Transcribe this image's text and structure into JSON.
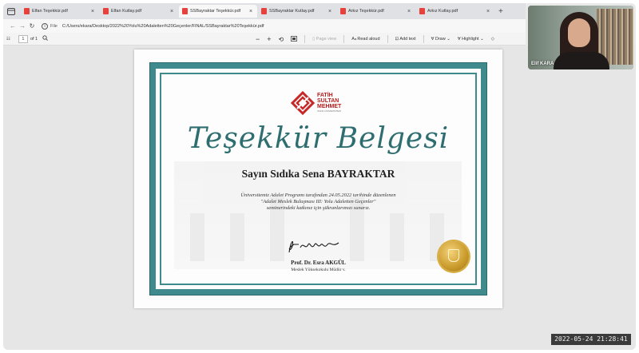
{
  "browser": {
    "tabs": [
      {
        "label": "Elfan Teşekkür.pdf",
        "active": false
      },
      {
        "label": "Elfan Kutlay.pdf",
        "active": false
      },
      {
        "label": "SSBayraktar Teşekkür.pdf",
        "active": true
      },
      {
        "label": "SSBayraktar Kutlay.pdf",
        "active": false
      },
      {
        "label": "Arkız Teşekkür.pdf",
        "active": false
      },
      {
        "label": "Arkız Kutlay.pdf",
        "active": false
      }
    ],
    "new_tab_label": "+",
    "address": {
      "scheme_label": "File",
      "url": "C:/Users/ekara/Desktop/2022%20Yolu%20Adaletten%20Geçenler/FINAL/SSBayraktar%20Teşekkür.pdf"
    }
  },
  "pdf_toolbar": {
    "page_current": "1",
    "page_total": "of 1",
    "zoom_out": "−",
    "zoom_in": "+",
    "page_view": "Page view",
    "read_aloud": "Read aloud",
    "add_text": "Add text",
    "draw": "Draw",
    "highlight": "Highlight"
  },
  "certificate": {
    "logo": {
      "line1": "FATİH",
      "line2": "SULTAN",
      "line3": "MEHMET",
      "line4": "VAKIF ÜNİVERSİTESİ"
    },
    "title": "Teşekkür Belgesi",
    "recipient": "Sayın Sıdıka Sena BAYRAKTAR",
    "body_line1": "Üniversitemiz Adalet Programı tarafından 24.05.2022 tarihinde düzenlenen",
    "body_line2": "\"Adalet Meslek Buluşması III: Yolu Adaletten Geçenler\"",
    "body_line3": "seminerindeki katkınız için şükranlarımızı sunarız.",
    "signer_name": "Prof. Dr. Esra AKGÜL",
    "signer_role": "Meslek Yüksekokulu Müdür v."
  },
  "webcam": {
    "participant": "Elif KARA"
  },
  "timestamp": "2022-05-24 21:28:41",
  "colors": {
    "frame_teal": "#3f8a8c",
    "title_teal": "#2f6e70",
    "logo_red": "#b71c1c",
    "seal_gold": "#c99a2a"
  }
}
